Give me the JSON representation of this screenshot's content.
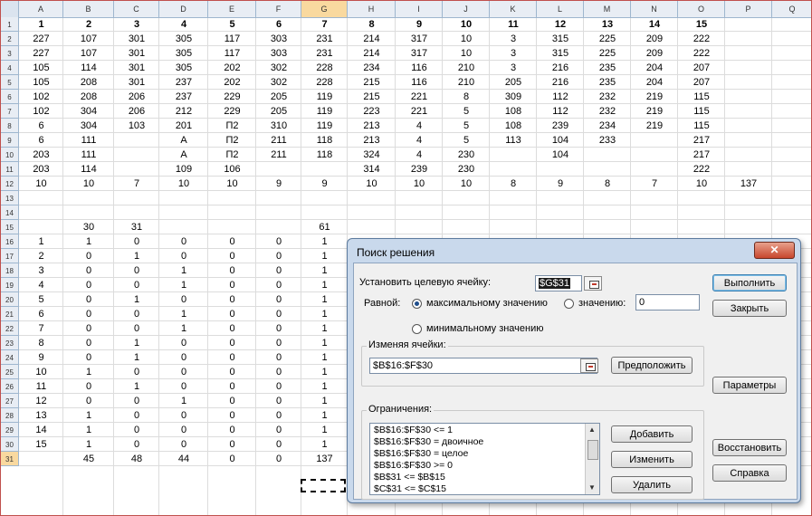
{
  "columns": [
    "A",
    "B",
    "C",
    "D",
    "E",
    "F",
    "G",
    "H",
    "I",
    "J",
    "K",
    "L",
    "M",
    "N",
    "O",
    "P",
    "Q"
  ],
  "selected_column": "G",
  "selected_row": "31",
  "rows": [
    {
      "n": "1",
      "cells": [
        "1",
        "2",
        "3",
        "4",
        "5",
        "6",
        "7",
        "8",
        "9",
        "10",
        "11",
        "12",
        "13",
        "14",
        "15",
        "",
        ""
      ],
      "bold": true
    },
    {
      "n": "2",
      "cells": [
        "227",
        "107",
        "301",
        "305",
        "117",
        "303",
        "231",
        "214",
        "317",
        "10",
        "3",
        "315",
        "225",
        "209",
        "222",
        "",
        ""
      ]
    },
    {
      "n": "3",
      "cells": [
        "227",
        "107",
        "301",
        "305",
        "117",
        "303",
        "231",
        "214",
        "317",
        "10",
        "3",
        "315",
        "225",
        "209",
        "222",
        "",
        ""
      ]
    },
    {
      "n": "4",
      "cells": [
        "105",
        "114",
        "301",
        "305",
        "202",
        "302",
        "228",
        "234",
        "116",
        "210",
        "3",
        "216",
        "235",
        "204",
        "207",
        "",
        ""
      ]
    },
    {
      "n": "5",
      "cells": [
        "105",
        "208",
        "301",
        "237",
        "202",
        "302",
        "228",
        "215",
        "116",
        "210",
        "205",
        "216",
        "235",
        "204",
        "207",
        "",
        ""
      ]
    },
    {
      "n": "6",
      "cells": [
        "102",
        "208",
        "206",
        "237",
        "229",
        "205",
        "119",
        "215",
        "221",
        "8",
        "309",
        "112",
        "232",
        "219",
        "115",
        "",
        ""
      ]
    },
    {
      "n": "7",
      "cells": [
        "102",
        "304",
        "206",
        "212",
        "229",
        "205",
        "119",
        "223",
        "221",
        "5",
        "108",
        "112",
        "232",
        "219",
        "115",
        "",
        ""
      ]
    },
    {
      "n": "8",
      "cells": [
        "6",
        "304",
        "103",
        "201",
        "П2",
        "310",
        "119",
        "213",
        "4",
        "5",
        "108",
        "239",
        "234",
        "219",
        "115",
        "",
        ""
      ]
    },
    {
      "n": "9",
      "cells": [
        "6",
        "111",
        "",
        "А",
        "П2",
        "211",
        "118",
        "213",
        "4",
        "5",
        "113",
        "104",
        "233",
        "",
        "217",
        "",
        ""
      ]
    },
    {
      "n": "10",
      "cells": [
        "203",
        "111",
        "",
        "А",
        "П2",
        "211",
        "118",
        "324",
        "4",
        "230",
        "",
        "104",
        "",
        "",
        "217",
        "",
        ""
      ]
    },
    {
      "n": "11",
      "cells": [
        "203",
        "114",
        "",
        "109",
        "106",
        "",
        "",
        "314",
        "239",
        "230",
        "",
        "",
        "",
        "",
        "222",
        "",
        ""
      ]
    },
    {
      "n": "12",
      "cells": [
        "10",
        "10",
        "7",
        "10",
        "10",
        "9",
        "9",
        "10",
        "10",
        "10",
        "8",
        "9",
        "8",
        "7",
        "10",
        "137",
        ""
      ]
    },
    {
      "n": "13",
      "cells": [
        "",
        "",
        "",
        "",
        "",
        "",
        "",
        "",
        "",
        "",
        "",
        "",
        "",
        "",
        "",
        "",
        ""
      ]
    },
    {
      "n": "14",
      "cells": [
        "",
        "",
        "",
        "",
        "",
        "",
        "",
        "",
        "",
        "",
        "",
        "",
        "",
        "",
        "",
        "",
        ""
      ]
    },
    {
      "n": "15",
      "cells": [
        "",
        "30",
        "31",
        "",
        "",
        "",
        "61",
        "",
        "",
        "",
        "",
        "",
        "",
        "",
        "",
        "",
        ""
      ]
    },
    {
      "n": "16",
      "cells": [
        "1",
        "1",
        "0",
        "0",
        "0",
        "0",
        "1",
        "",
        "",
        "",
        "",
        "",
        "",
        "",
        "",
        "",
        ""
      ]
    },
    {
      "n": "17",
      "cells": [
        "2",
        "0",
        "1",
        "0",
        "0",
        "0",
        "1",
        "",
        "",
        "",
        "",
        "",
        "",
        "",
        "",
        "",
        ""
      ]
    },
    {
      "n": "18",
      "cells": [
        "3",
        "0",
        "0",
        "1",
        "0",
        "0",
        "1",
        "",
        "",
        "",
        "",
        "",
        "",
        "",
        "",
        "",
        ""
      ]
    },
    {
      "n": "19",
      "cells": [
        "4",
        "0",
        "0",
        "1",
        "0",
        "0",
        "1",
        "",
        "",
        "",
        "",
        "",
        "",
        "",
        "",
        "",
        ""
      ]
    },
    {
      "n": "20",
      "cells": [
        "5",
        "0",
        "1",
        "0",
        "0",
        "0",
        "1",
        "",
        "",
        "",
        "",
        "",
        "",
        "",
        "",
        "",
        ""
      ]
    },
    {
      "n": "21",
      "cells": [
        "6",
        "0",
        "0",
        "1",
        "0",
        "0",
        "1",
        "",
        "",
        "",
        "",
        "",
        "",
        "",
        "",
        "",
        ""
      ]
    },
    {
      "n": "22",
      "cells": [
        "7",
        "0",
        "0",
        "1",
        "0",
        "0",
        "1",
        "",
        "",
        "",
        "",
        "",
        "",
        "",
        "",
        "",
        ""
      ]
    },
    {
      "n": "23",
      "cells": [
        "8",
        "0",
        "1",
        "0",
        "0",
        "0",
        "1",
        "",
        "",
        "",
        "",
        "",
        "",
        "",
        "",
        "",
        ""
      ]
    },
    {
      "n": "24",
      "cells": [
        "9",
        "0",
        "1",
        "0",
        "0",
        "0",
        "1",
        "",
        "",
        "",
        "",
        "",
        "",
        "",
        "",
        "",
        ""
      ]
    },
    {
      "n": "25",
      "cells": [
        "10",
        "1",
        "0",
        "0",
        "0",
        "0",
        "1",
        "",
        "",
        "",
        "",
        "",
        "",
        "",
        "",
        "",
        ""
      ]
    },
    {
      "n": "26",
      "cells": [
        "11",
        "0",
        "1",
        "0",
        "0",
        "0",
        "1",
        "",
        "",
        "",
        "",
        "",
        "",
        "",
        "",
        "",
        ""
      ]
    },
    {
      "n": "27",
      "cells": [
        "12",
        "0",
        "0",
        "1",
        "0",
        "0",
        "1",
        "",
        "",
        "",
        "",
        "",
        "",
        "",
        "",
        "",
        ""
      ]
    },
    {
      "n": "28",
      "cells": [
        "13",
        "1",
        "0",
        "0",
        "0",
        "0",
        "1",
        "",
        "",
        "",
        "",
        "",
        "",
        "",
        "",
        "",
        ""
      ]
    },
    {
      "n": "29",
      "cells": [
        "14",
        "1",
        "0",
        "0",
        "0",
        "0",
        "1",
        "",
        "",
        "",
        "",
        "",
        "",
        "",
        "",
        "",
        ""
      ]
    },
    {
      "n": "30",
      "cells": [
        "15",
        "1",
        "0",
        "0",
        "0",
        "0",
        "1",
        "",
        "",
        "",
        "",
        "",
        "",
        "",
        "",
        "",
        ""
      ]
    },
    {
      "n": "31",
      "cells": [
        "",
        "45",
        "48",
        "44",
        "0",
        "0",
        "137",
        "",
        "",
        "",
        "",
        "",
        "",
        "",
        "",
        "",
        ""
      ]
    }
  ],
  "dialog": {
    "title": "Поиск решения",
    "close_glyph": "✕",
    "target_label": "Установить целевую ячейку:",
    "target_value": "$G$31",
    "equal_label": "Равной:",
    "opt_max": "максимальному значению",
    "opt_value": "значению:",
    "value_field": "0",
    "opt_min": "минимальному значению",
    "changing_label": "Изменяя ячейки:",
    "changing_value": "$B$16:$F$30",
    "guess_button": "Предположить",
    "constraints_label": "Ограничения:",
    "constraints": [
      "$B$16:$F$30 <= 1",
      "$B$16:$F$30 = двоичное",
      "$B$16:$F$30 = целое",
      "$B$16:$F$30 >= 0",
      "$B$31 <= $B$15",
      "$C$31 <= $C$15"
    ],
    "add_button": "Добавить",
    "change_button": "Изменить",
    "delete_button": "Удалить",
    "solve_button": "Выполнить",
    "close_button": "Закрыть",
    "params_button": "Параметры",
    "reset_button": "Восстановить",
    "help_button": "Справка"
  },
  "colors": {
    "header_bg": "#e8edf4",
    "selected_header": "#f9d99f",
    "dialog_frame": "#c9d9ec",
    "close_red": "#c8472e"
  },
  "icons": {
    "ref_button": "collapse-dialog-icon",
    "scroll_up": "scroll-up-arrow-icon",
    "scroll_down": "scroll-down-arrow-icon"
  }
}
